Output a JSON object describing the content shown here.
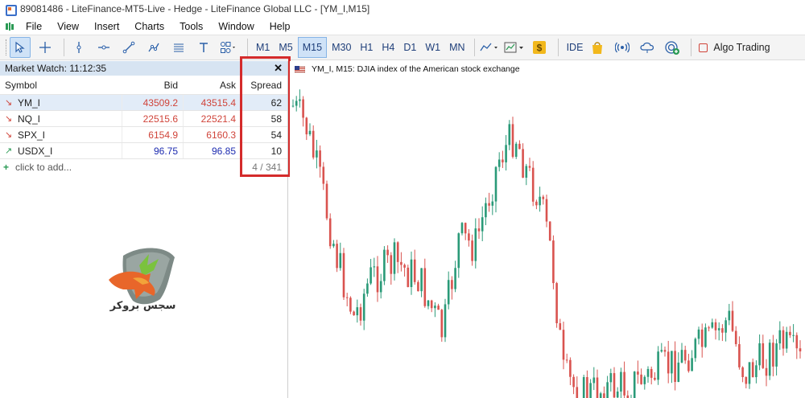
{
  "window": {
    "title": "89081486 - LiteFinance-MT5-Live - Hedge - LiteFinance Global LLC - [YM_I,M15]"
  },
  "menu": [
    "File",
    "View",
    "Insert",
    "Charts",
    "Tools",
    "Window",
    "Help"
  ],
  "toolbar": {
    "tools": [
      "cursor-icon",
      "crosshair-icon",
      "vertical-line-icon",
      "horizontal-line-icon",
      "trendline-icon",
      "drawing-tools-icon",
      "channels-icon",
      "text-tool-icon",
      "shapes-icon"
    ],
    "timeframes": [
      "M1",
      "M5",
      "M15",
      "M30",
      "H1",
      "H4",
      "D1",
      "W1",
      "MN"
    ],
    "active_timeframe": "M15",
    "ide_label": "IDE",
    "algo_label": "Algo Trading"
  },
  "market_watch": {
    "title": "Market Watch: 11:12:35",
    "columns": [
      "Symbol",
      "Bid",
      "Ask",
      "Spread"
    ],
    "rows": [
      {
        "symbol": "YM_I",
        "bid": "43509.2",
        "ask": "43515.4",
        "spread": "62",
        "dir": "down"
      },
      {
        "symbol": "NQ_I",
        "bid": "22515.6",
        "ask": "22521.4",
        "spread": "58",
        "dir": "down"
      },
      {
        "symbol": "SPX_I",
        "bid": "6154.9",
        "ask": "6160.3",
        "spread": "54",
        "dir": "down"
      },
      {
        "symbol": "USDX_I",
        "bid": "96.75",
        "ask": "96.85",
        "spread": "10",
        "dir": "up"
      }
    ],
    "add_label": "click to add...",
    "count": "4 / 341"
  },
  "logo_text": "سجس بروکر",
  "chart": {
    "header": "YM_I, M15:  DJIA index of the American stock exchange",
    "up_color": "#2a9a78",
    "down_color": "#d9534f"
  },
  "colors": {
    "highlight": "#d42b2b",
    "selection": "#cfe2f7"
  }
}
